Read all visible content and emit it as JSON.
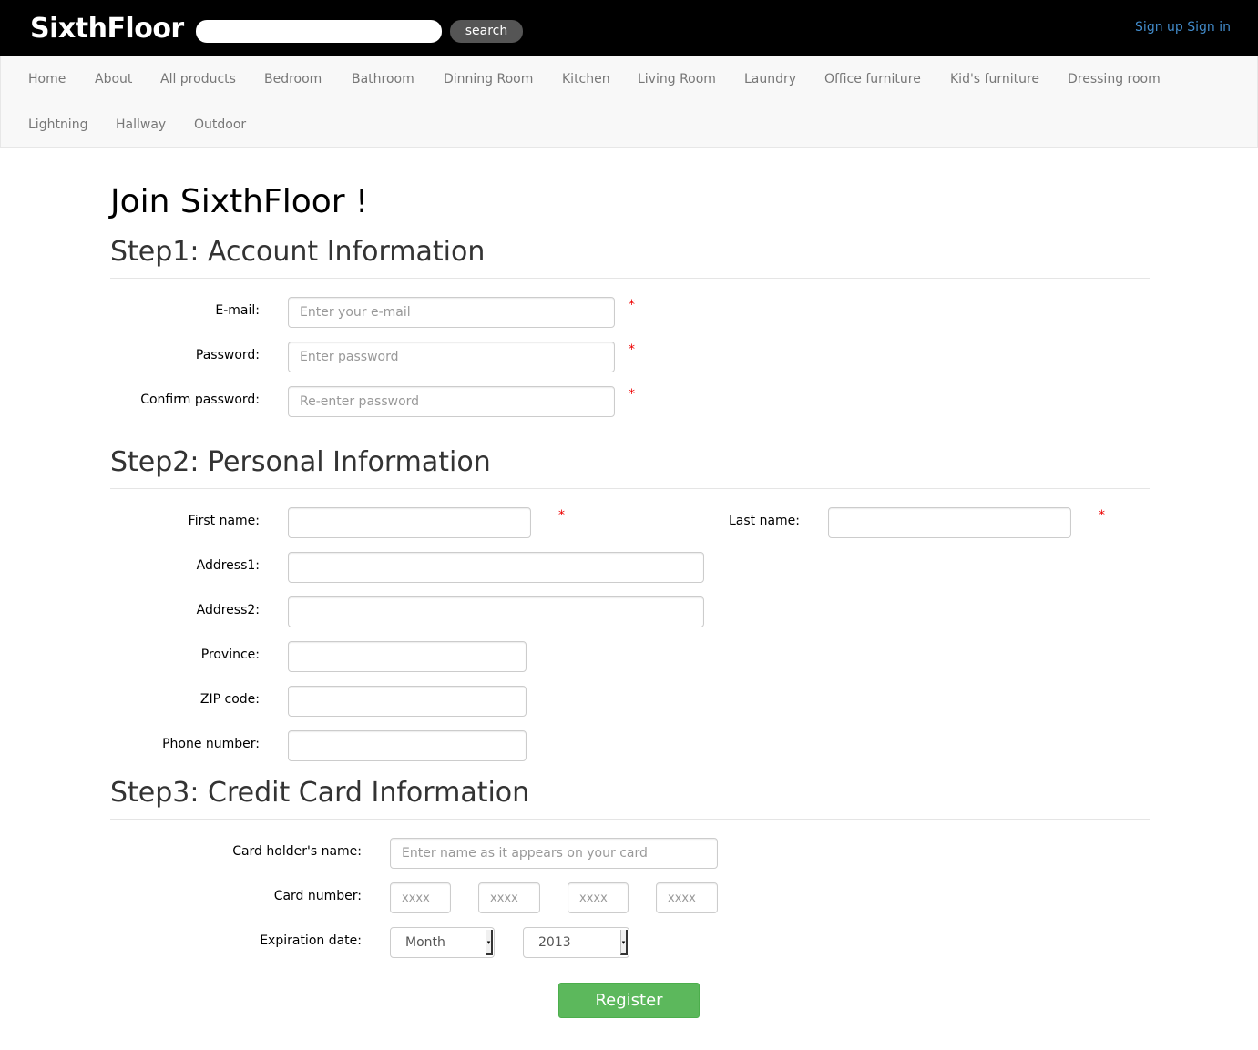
{
  "header": {
    "brand": "SixthFloor",
    "search_placeholder": "",
    "search_button": "search",
    "signup": "Sign up",
    "signin": "Sign in"
  },
  "nav": {
    "items": [
      "Home",
      "About",
      "All products",
      "Bedroom",
      "Bathroom",
      "Dinning Room",
      "Kitchen",
      "Living Room",
      "Laundry",
      "Office furniture",
      "Kid's furniture",
      "Dressing room",
      "Lightning",
      "Hallway",
      "Outdoor"
    ]
  },
  "page": {
    "title": "Join SixthFloor !"
  },
  "step1": {
    "title": "Step1: Account Information",
    "email_label": "E-mail:",
    "email_placeholder": "Enter your e-mail",
    "password_label": "Password:",
    "password_placeholder": "Enter password",
    "confirm_label": "Confirm password:",
    "confirm_placeholder": "Re-enter password",
    "required_mark": "*"
  },
  "step2": {
    "title": "Step2: Personal Information",
    "first_name_label": "First name:",
    "last_name_label": "Last name:",
    "address1_label": "Address1:",
    "address2_label": "Address2:",
    "province_label": "Province:",
    "zip_label": "ZIP code:",
    "phone_label": "Phone number:",
    "required_mark": "*"
  },
  "step3": {
    "title": "Step3: Credit Card Information",
    "holder_label": "Card holder's name:",
    "holder_placeholder": "Enter name as it appears on your card",
    "card_number_label": "Card number:",
    "card_placeholder": "xxxx",
    "expiration_label": "Expiration date:",
    "month_value": "Month",
    "year_value": "2013"
  },
  "actions": {
    "register": "Register"
  },
  "colors": {
    "topbar": "#000000",
    "link": "#428bca",
    "required": "#ee0000",
    "register": "#5cb85c"
  }
}
